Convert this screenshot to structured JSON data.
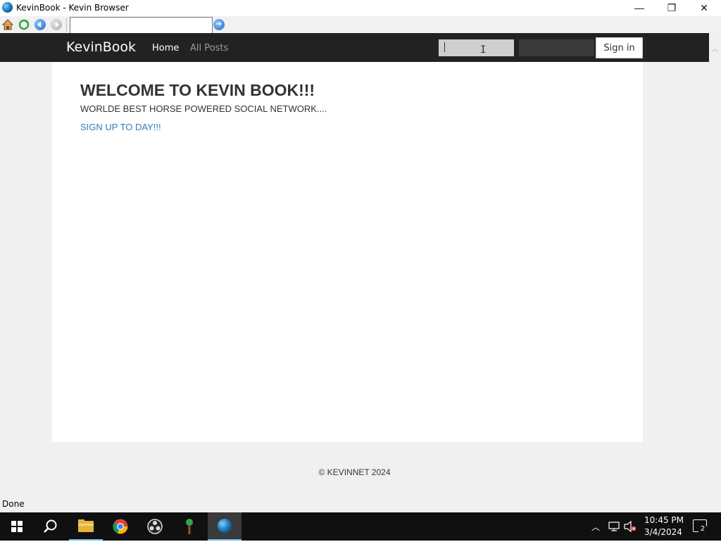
{
  "window": {
    "title": "KevinBook - Kevin Browser",
    "controls": {
      "minimize": "—",
      "restore": "❐",
      "close": "✕"
    }
  },
  "toolbar": {
    "address_value": "",
    "go_icon": "go-arrow-icon"
  },
  "site": {
    "brand": "KevinBook",
    "nav": {
      "home": "Home",
      "all_posts": "All Posts"
    },
    "login": {
      "username_value": "",
      "password_value": "",
      "signin_label": "Sign in"
    },
    "hero": {
      "heading": "WELCOME TO KEVIN BOOK!!!",
      "tagline": "WORLDE BEST HORSE POWERED SOCIAL NETWORK....",
      "signup_link": "SIGN UP TO DAY!!!"
    },
    "footer": "© KEVINNET 2024",
    "colors": {
      "navbar": "#222222",
      "link": "#337ab7",
      "page_bg": "#f0f0f0"
    }
  },
  "statusbar": {
    "text": "Done"
  },
  "taskbar": {
    "apps": [
      "start-icon",
      "search-icon",
      "file-explorer-icon",
      "chrome-icon",
      "obs-icon",
      "tree-app-icon",
      "kevin-browser-icon"
    ],
    "clock": {
      "time": "10:45 PM",
      "date": "3/4/2024"
    },
    "notification_count": "2"
  }
}
